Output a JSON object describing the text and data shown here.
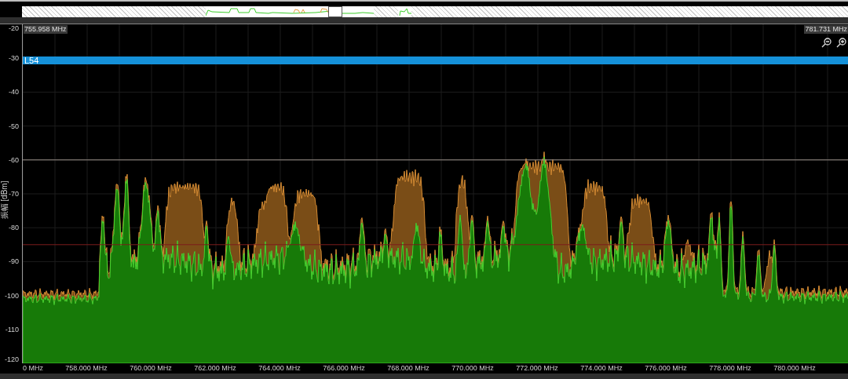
{
  "markers": {
    "start_frequency": "755.958 MHz",
    "stop_frequency": "781.731 MHz"
  },
  "band": {
    "label": "L54"
  },
  "y_axis": {
    "label": "振幅 [dBm]",
    "ticks": [
      "-20",
      "-30",
      "-40",
      "-50",
      "-60",
      "-70",
      "-80",
      "-90",
      "-100",
      "-110",
      "-120"
    ]
  },
  "x_axis": {
    "ticks": [
      "0 MHz",
      "758.000 MHz",
      "760.000 MHz",
      "762.000 MHz",
      "764.000 MHz",
      "766.000 MHz",
      "768.000 MHz",
      "770.000 MHz",
      "772.000 MHz",
      "774.000 MHz",
      "776.000 MHz",
      "778.000 MHz",
      "780.000 MHz"
    ]
  }
}
